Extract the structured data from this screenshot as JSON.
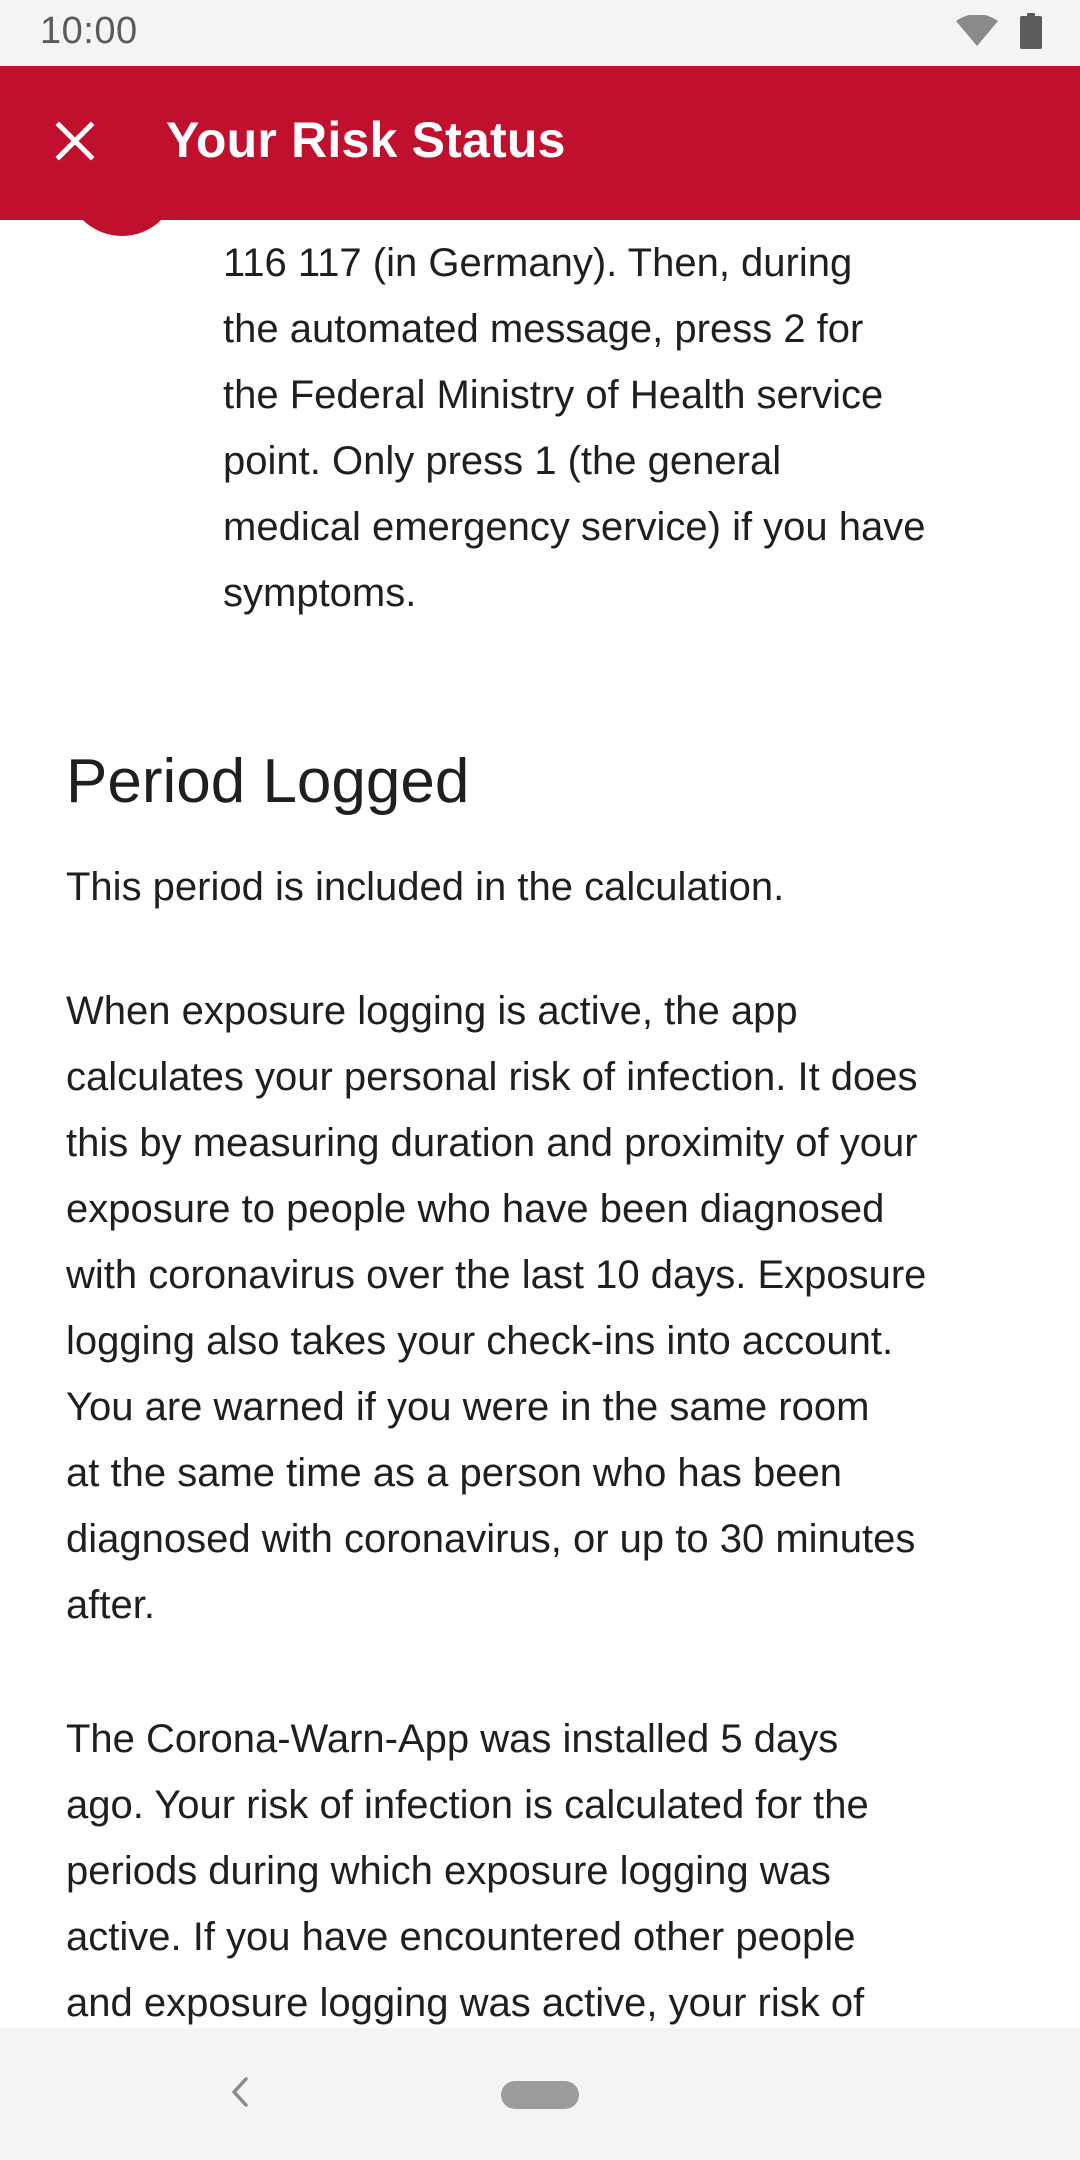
{
  "status_bar": {
    "time": "10:00",
    "icons": [
      "wifi-icon",
      "battery-icon"
    ]
  },
  "app_bar": {
    "close_icon": "close-icon",
    "title": "Your Risk Status",
    "background": "#c1102e"
  },
  "hotline_step": {
    "icon": "phone-icon",
    "text": "116 117 (in Germany). Then, during\nthe automated message, press 2 for\nthe Federal Ministry of Health service\npoint. Only press 1 (the general\nmedical emergency service) if you have\nsymptoms."
  },
  "period_logged": {
    "title": "Period Logged",
    "subtitle": "This period is included in the calculation.",
    "paragraph_1": "When exposure logging is active, the app\ncalculates your personal risk of infection. It does\nthis by measuring duration and proximity of your\nexposure to people who have been diagnosed\nwith coronavirus over the last 10 days. Exposure\nlogging also takes your check-ins into account.\nYou are warned if you were in the same room\nat the same time as a person who has been\ndiagnosed with coronavirus, or up to 30 minutes\nafter.",
    "paragraph_2": "The Corona-Warn-App was installed 5 days\nago. Your risk of infection is calculated for the\nperiods during which exposure logging was\nactive. If you have encountered other people\nand exposure logging was active, your risk of"
  },
  "nav_bar": {
    "back_icon": "back-chevron-icon",
    "home_icon": "home-pill-icon"
  }
}
